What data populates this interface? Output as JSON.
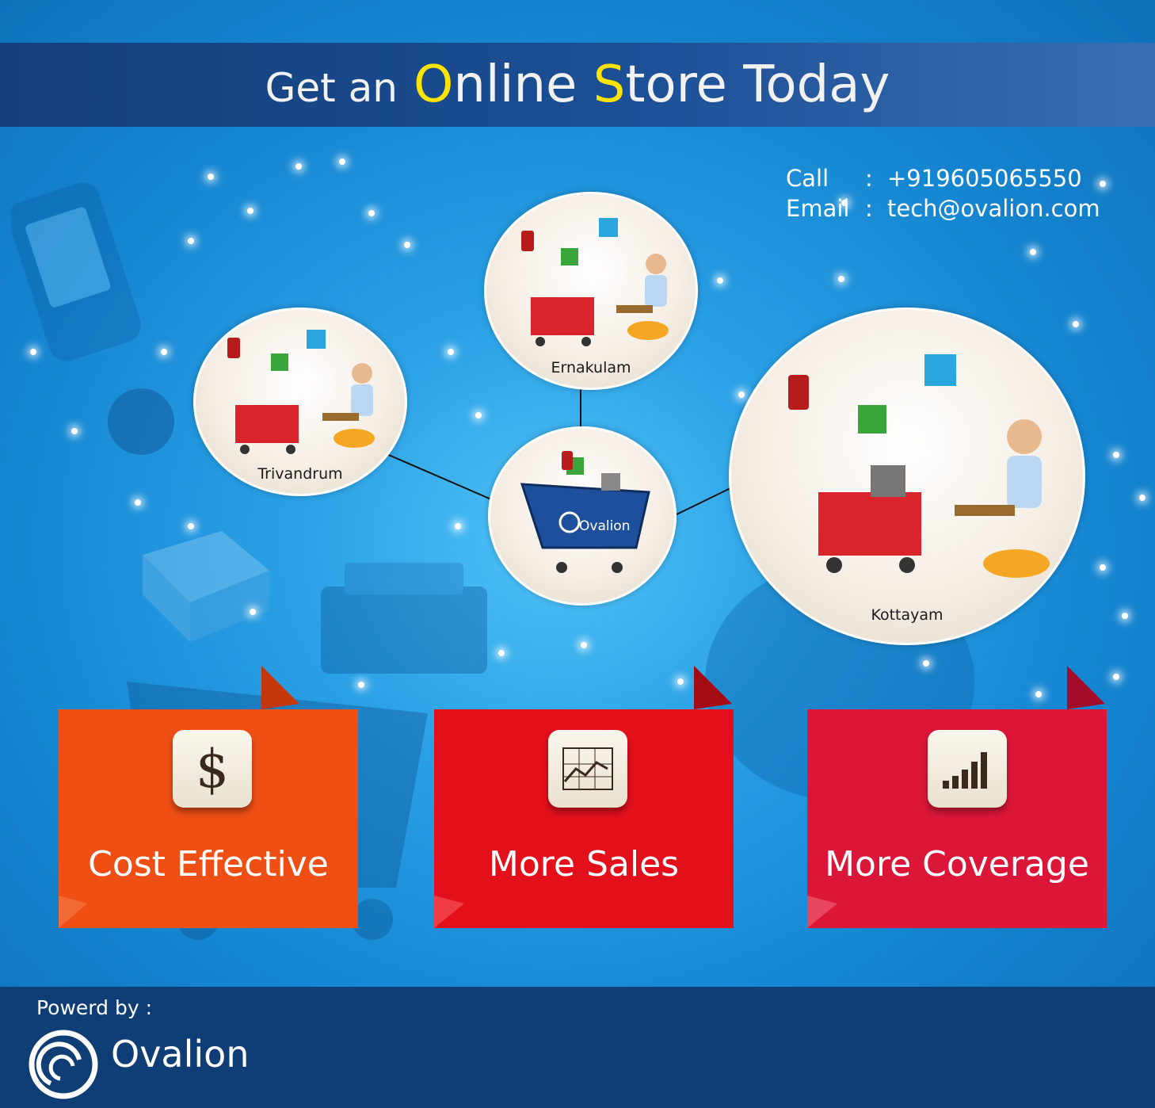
{
  "header": {
    "prefix": "Get an",
    "word1_first": "O",
    "word1_rest": "nline",
    "word2_first": "S",
    "word2_rest": "tore",
    "word3": "Today",
    "highlight_color": "#ffe400"
  },
  "contact": {
    "call_label": "Call",
    "call_sep": ":",
    "call_value": "+919605065550",
    "email_label": "Email",
    "email_sep": ":",
    "email_value": "tech@ovalion.com"
  },
  "locations": [
    {
      "name": "Trivandrum"
    },
    {
      "name": "Ernakulam"
    },
    {
      "name": "Kottayam"
    }
  ],
  "hub": {
    "brand": "Ovalion"
  },
  "features": [
    {
      "label": "Cost Effective",
      "icon": "dollar-icon",
      "color": "#ef4f14"
    },
    {
      "label": "More Sales",
      "icon": "line-chart-icon",
      "color": "#e3101c"
    },
    {
      "label": "More Coverage",
      "icon": "signal-bars-icon",
      "color": "#dc1639"
    }
  ],
  "footer": {
    "powered_label": "Powerd by :",
    "brand": "Ovalion"
  }
}
